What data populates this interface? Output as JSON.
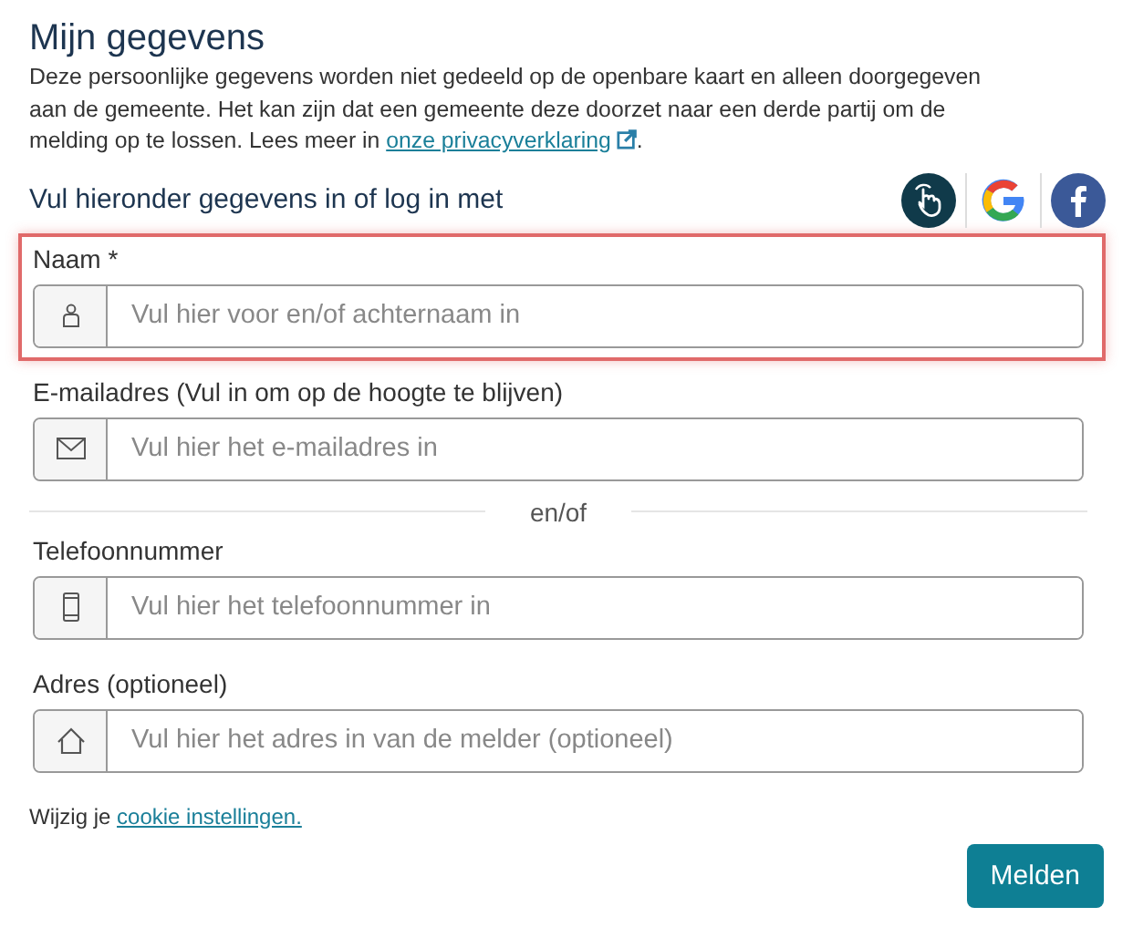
{
  "title": "Mijn gegevens",
  "intro": {
    "text": "Deze persoonlijke gegevens worden niet gedeeld op de openbare kaart en alleen doorgegeven aan de gemeente. Het kan zijn dat een gemeente deze doorzet naar een derde partij om de melding op te lossen. Lees meer in",
    "link": "onze privacyverklaring",
    "after": "."
  },
  "login_prompt": "Vul hieronder gegevens in of log in met",
  "login_options": [
    {
      "kind": "hand"
    },
    {
      "kind": "google"
    },
    {
      "kind": "facebook"
    }
  ],
  "fields": [
    {
      "label": "Naam *",
      "kind": "person",
      "placeholder": "Vul hier voor en/of achternaam in",
      "highlighted": true
    },
    {
      "label": "E-mailadres (Vul in om op de hoogte te blijven)",
      "kind": "mail",
      "placeholder": "Vul hier het e-mailadres in",
      "highlighted": false,
      "separator_after": "en/of"
    },
    {
      "label": "Telefoonnummer",
      "kind": "phone",
      "placeholder": "Vul hier het telefoonnummer in",
      "highlighted": false
    },
    {
      "label": "Adres (optioneel)",
      "kind": "home",
      "placeholder": "Vul hier het adres in van de melder (optioneel)",
      "highlighted": false
    }
  ],
  "cookie": {
    "text": "Wijzig je",
    "link": "cookie instellingen."
  },
  "submit": "Melden"
}
